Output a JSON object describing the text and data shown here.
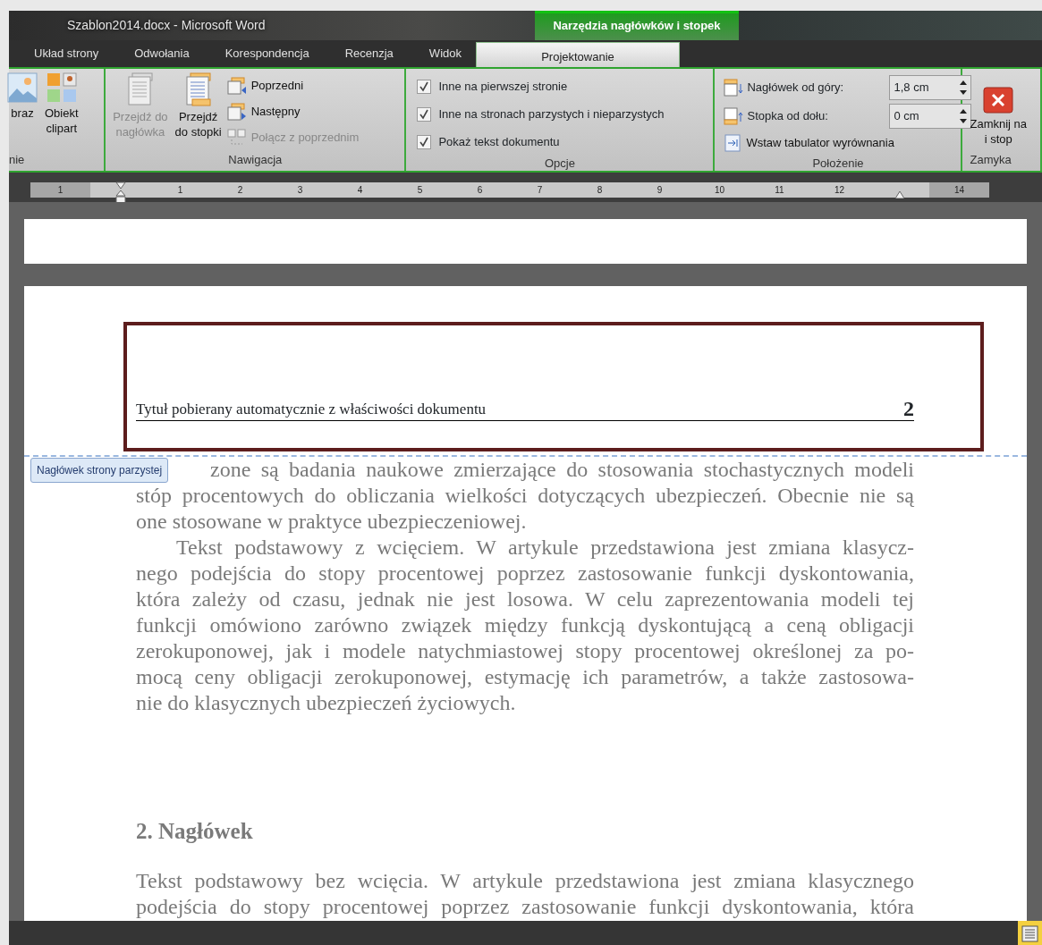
{
  "window": {
    "title": "Szablon2014.docx - Microsoft Word"
  },
  "contextual_group": "Narzędzia nagłówków i stopek",
  "tabs": [
    {
      "label": "Układ strony",
      "selected": false
    },
    {
      "label": "Odwołania",
      "selected": false
    },
    {
      "label": "Korespondencja",
      "selected": false
    },
    {
      "label": "Recenzja",
      "selected": false
    },
    {
      "label": "Widok",
      "selected": false
    },
    {
      "label": "Projektowanie",
      "selected": true
    }
  ],
  "ribbon_groups": [
    {
      "label": "nie",
      "items": [
        {
          "kind": "large",
          "lines": [
            "braz"
          ],
          "disabled": false
        },
        {
          "kind": "large",
          "lines": [
            "Obiekt",
            "clipart"
          ],
          "disabled": false
        }
      ]
    },
    {
      "label": "Nawigacja",
      "items": [
        {
          "kind": "large",
          "lines": [
            "Przejdź do",
            "nagłówka"
          ],
          "disabled": true
        },
        {
          "kind": "large",
          "lines": [
            "Przejdź",
            "do stopki"
          ],
          "disabled": false
        },
        {
          "kind": "small",
          "label": "Poprzedni",
          "disabled": false
        },
        {
          "kind": "small",
          "label": "Następny",
          "disabled": false
        },
        {
          "kind": "small",
          "label": "Połącz z poprzednim",
          "disabled": true
        }
      ]
    },
    {
      "label": "Opcje",
      "items": [
        {
          "kind": "checkbox",
          "label": "Inne na pierwszej stronie",
          "checked": true
        },
        {
          "kind": "checkbox",
          "label": "Inne na stronach parzystych i nieparzystych",
          "checked": true
        },
        {
          "kind": "checkbox",
          "label": "Pokaż tekst dokumentu",
          "checked": true
        }
      ]
    },
    {
      "label": "Położenie",
      "items": [
        {
          "kind": "spin",
          "label": "Nagłówek od góry:",
          "value": "1,8 cm"
        },
        {
          "kind": "spin",
          "label": "Stopka od dołu:",
          "value": "0 cm"
        },
        {
          "kind": "small",
          "label": "Wstaw tabulator wyrównania",
          "disabled": false
        }
      ]
    },
    {
      "label": "Zamyka",
      "items": [
        {
          "kind": "large",
          "lines": [
            "Zamknij na",
            "i stop"
          ],
          "disabled": false
        }
      ]
    }
  ],
  "ruler": [
    {
      "kind": "number",
      "text": "1"
    },
    {
      "kind": "indent-marker"
    },
    {
      "kind": "number",
      "text": "1"
    },
    {
      "kind": "number",
      "text": "2"
    },
    {
      "kind": "number",
      "text": "3"
    },
    {
      "kind": "number",
      "text": "4"
    },
    {
      "kind": "number",
      "text": "5"
    },
    {
      "kind": "number",
      "text": "6"
    },
    {
      "kind": "number",
      "text": "7"
    },
    {
      "kind": "number",
      "text": "8"
    },
    {
      "kind": "number",
      "text": "9"
    },
    {
      "kind": "number",
      "text": "10"
    },
    {
      "kind": "number",
      "text": "11"
    },
    {
      "kind": "number",
      "text": "12"
    },
    {
      "kind": "margin-marker"
    },
    {
      "kind": "number",
      "text": "14"
    }
  ],
  "header": {
    "title": "Tytuł pobierany automatycznie z właściwości dokumentu",
    "page_number": "2",
    "tooltip": "Nagłówek strony parzystej"
  },
  "body": [
    {
      "kind": "fragment",
      "lines": [
        "zone są badania naukowe zmierzające do stosowania stochastycznych modeli"
      ]
    },
    {
      "kind": "paragraph",
      "indent": false,
      "lines": [
        "stóp procentowych do obliczania wielkości dotyczących ubezpieczeń. Obecnie nie są",
        "one stosowane w praktyce ubezpieczeniowej."
      ]
    },
    {
      "kind": "paragraph",
      "indent": true,
      "lines": [
        "Tekst podstawowy z wcięciem. W artykule przedstawiona jest zmiana klasycz-",
        "nego podejścia do stopy procentowej poprzez zastosowanie funkcji dyskontowania,",
        "która zależy od czasu, jednak nie jest losowa. W celu zaprezentowania modeli tej",
        "funkcji omówiono zarówno związek między funkcją dyskontującą a ceną obligacji",
        "zerokuponowej, jak i modele natychmiastowej stopy procentowej określonej za po-",
        "mocą ceny obligacji zerokuponowej, estymację ich parametrów, a także zastosowa-",
        "nie do klasycznych ubezpieczeń życiowych."
      ]
    },
    {
      "kind": "heading",
      "lines": [
        "2. Nagłówek"
      ]
    },
    {
      "kind": "paragraph",
      "indent": false,
      "lines": [
        "Tekst podstawowy bez wcięcia. W artykule przedstawiona jest zmiana klasycznego",
        "podejścia do stopy procentowej poprzez zastosowanie funkcji dyskontowania, która"
      ]
    }
  ]
}
